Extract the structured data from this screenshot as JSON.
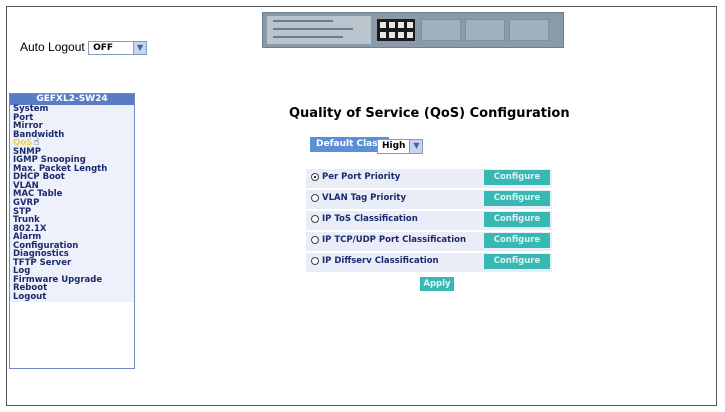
{
  "header": {
    "auto_logout_label": "Auto Logout",
    "auto_logout_value": "OFF"
  },
  "menu": {
    "title": "GEFXL2-SW24",
    "items": [
      {
        "label": "System"
      },
      {
        "label": "Port"
      },
      {
        "label": "Mirror"
      },
      {
        "label": "Bandwidth"
      },
      {
        "label": "QoS"
      },
      {
        "label": "SNMP"
      },
      {
        "label": "IGMP Snooping"
      },
      {
        "label": "Max. Packet Length"
      },
      {
        "label": "DHCP Boot"
      },
      {
        "label": "VLAN"
      },
      {
        "label": "MAC Table"
      },
      {
        "label": "GVRP"
      },
      {
        "label": "STP"
      },
      {
        "label": "Trunk"
      },
      {
        "label": "802.1X"
      },
      {
        "label": "Alarm"
      },
      {
        "label": "Configuration"
      },
      {
        "label": "Diagnostics"
      },
      {
        "label": "TFTP Server"
      },
      {
        "label": "Log"
      },
      {
        "label": "Firmware Upgrade"
      },
      {
        "label": "Reboot"
      },
      {
        "label": "Logout"
      }
    ]
  },
  "main": {
    "title": "Quality of Service (QoS) Configuration",
    "default_class_label": "Default Class",
    "default_class_value": "High",
    "options": [
      {
        "label": "Per Port Priority",
        "button": "Configure",
        "selected": true
      },
      {
        "label": "VLAN Tag Priority",
        "button": "Configure",
        "selected": false
      },
      {
        "label": "IP ToS Classification",
        "button": "Configure",
        "selected": false
      },
      {
        "label": "IP TCP/UDP Port Classification",
        "button": "Configure",
        "selected": false
      },
      {
        "label": "IP Diffserv Classification",
        "button": "Configure",
        "selected": false
      }
    ],
    "apply_label": "Apply"
  },
  "colors": {
    "menu_title_bg": "#5a7cc4",
    "menu_text": "#1c2a6b",
    "button_teal": "#38b8b2",
    "default_class_bg": "#5d8fd6",
    "active_menu_text": "#e8d24a"
  }
}
